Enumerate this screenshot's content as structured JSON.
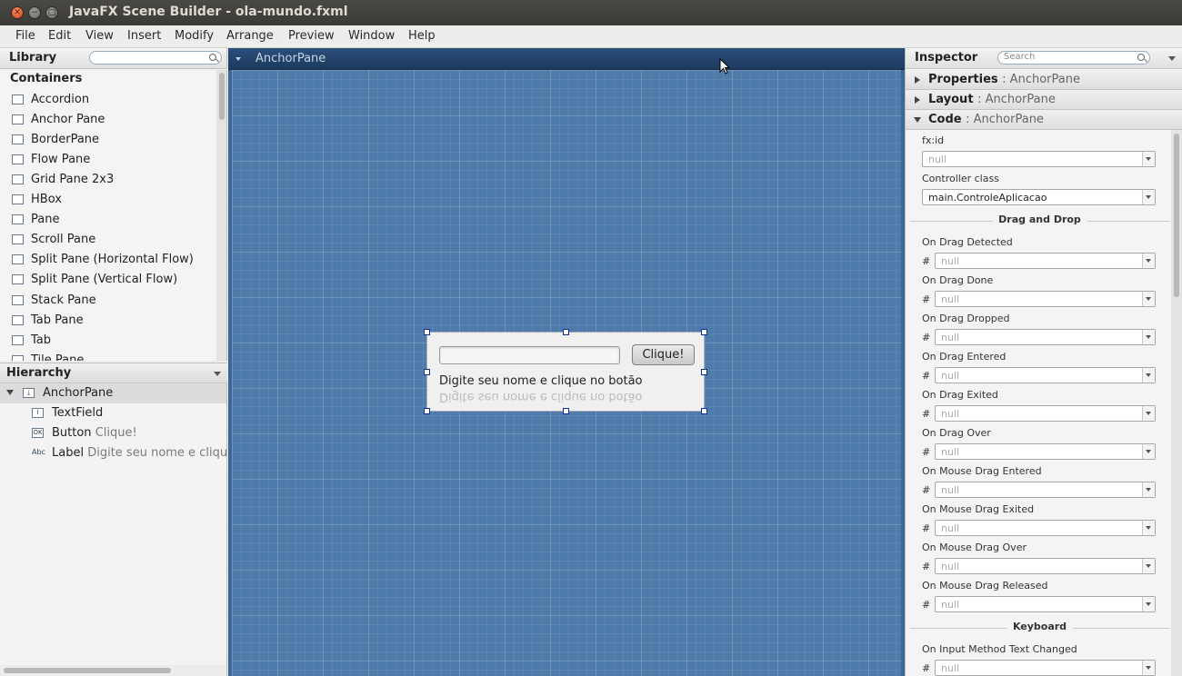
{
  "window": {
    "title": "JavaFX Scene Builder - ola-mundo.fxml"
  },
  "menu": [
    "File",
    "Edit",
    "View",
    "Insert",
    "Modify",
    "Arrange",
    "Preview",
    "Window",
    "Help"
  ],
  "library": {
    "title": "Library",
    "category": "Containers",
    "items": [
      "Accordion",
      "Anchor Pane",
      "BorderPane",
      "Flow Pane",
      "Grid Pane 2x3",
      "HBox",
      "Pane",
      "Scroll Pane",
      "Split Pane (Horizontal Flow)",
      "Split Pane (Vertical Flow)",
      "Stack Pane",
      "Tab Pane",
      "Tab",
      "Tile Pane"
    ]
  },
  "hierarchy": {
    "title": "Hierarchy",
    "root": {
      "type": "AnchorPane",
      "icon": "anchor-icon"
    },
    "children": [
      {
        "type": "TextField",
        "text": "",
        "icon": "textfield-icon"
      },
      {
        "type": "Button",
        "text": "Clique!",
        "icon": "button-icon"
      },
      {
        "type": "Label",
        "text": "Digite seu nome e cliqu",
        "icon": "label-icon"
      }
    ]
  },
  "content": {
    "header": "AnchorPane",
    "button_label": "Clique!",
    "label_text": "Digite seu nome e clique no botão"
  },
  "inspector": {
    "title": "Inspector",
    "search_placeholder": "Search",
    "sections": [
      {
        "title": "Properties",
        "sub": ": AnchorPane",
        "expanded": false
      },
      {
        "title": "Layout",
        "sub": ": AnchorPane",
        "expanded": false
      },
      {
        "title": "Code",
        "sub": ": AnchorPane",
        "expanded": true
      }
    ],
    "fxid_label": "fx:id",
    "fxid_value": "null",
    "controller_label": "Controller class",
    "controller_value": "main.ControleAplicacao",
    "group_dnd": "Drag and Drop",
    "handlers": [
      "On Drag Detected",
      "On Drag Done",
      "On Drag Dropped",
      "On Drag Entered",
      "On Drag Exited",
      "On Drag Over",
      "On Mouse Drag Entered",
      "On Mouse Drag Exited",
      "On Mouse Drag Over",
      "On Mouse Drag Released"
    ],
    "handler_value": "null",
    "hash": "#",
    "group_keyboard": "Keyboard",
    "keyboard_handlers": [
      "On Input Method Text Changed"
    ]
  },
  "colors": {
    "canvas": "#4f7bab",
    "header": "#1d3a5f",
    "selection_handle": "#0a2d9c"
  }
}
